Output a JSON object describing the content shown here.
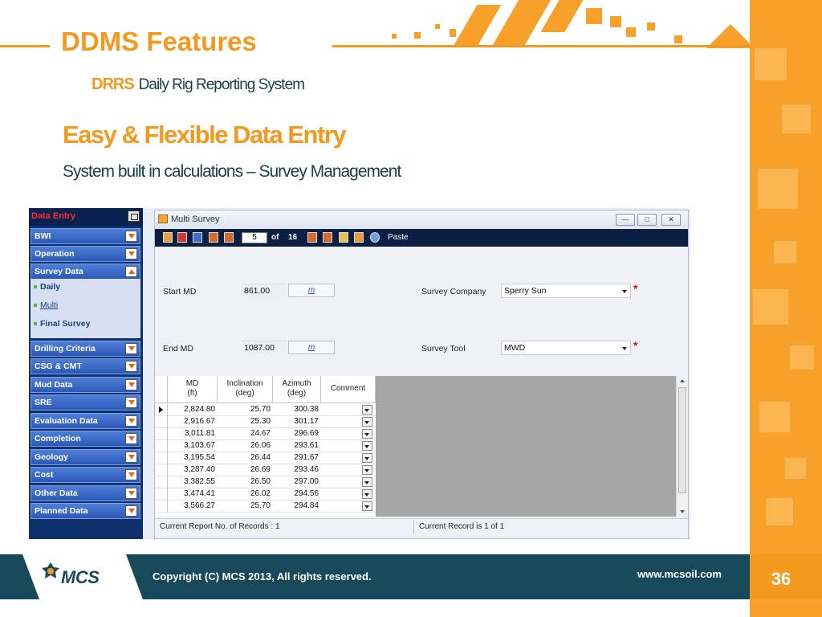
{
  "slide": {
    "title": "DDMS Features",
    "drrs_abbr": "DRRS",
    "drrs_full": "Daily Rig Reporting System",
    "heading": "Easy & Flexible Data Entry",
    "subheading": "System built in calculations – Survey Management",
    "page_number": "36"
  },
  "sidebar": {
    "header": "Data Entry",
    "items": [
      {
        "label": "BWI"
      },
      {
        "label": "Operation"
      },
      {
        "label": "Survey Data"
      },
      {
        "label": "Drilling Criteria"
      },
      {
        "label": "CSG & CMT"
      },
      {
        "label": "Mud Data"
      },
      {
        "label": "SRE"
      },
      {
        "label": "Evaluation Data"
      },
      {
        "label": "Completion"
      },
      {
        "label": "Geology"
      },
      {
        "label": "Cost"
      },
      {
        "label": "Other Data"
      },
      {
        "label": "Planned Data"
      }
    ],
    "survey_sub": [
      {
        "label": "Daily"
      },
      {
        "label": "Multi"
      },
      {
        "label": "Final Survey"
      }
    ]
  },
  "window": {
    "title": "Multi Survey",
    "pager_current": "5",
    "pager_of": "of",
    "pager_total": "16",
    "paste_label": "Paste"
  },
  "form": {
    "start_md_label": "Start MD",
    "start_md_value": "861.00",
    "end_md_label": "End MD",
    "end_md_value": "1087.00",
    "unit": "m",
    "survey_company_label": "Survey Company",
    "survey_company_value": "Sperry Sun",
    "survey_tool_label": "Survey Tool",
    "survey_tool_value": "MWD",
    "required_mark": "*"
  },
  "grid": {
    "headers": {
      "md": "MD",
      "md_unit": "(ft)",
      "inclination": "Inclination",
      "inclination_unit": "(deg)",
      "azimuth": "Azimuth",
      "azimuth_unit": "(deg)",
      "comment": "Comment"
    },
    "rows": [
      {
        "md": "2,824.80",
        "inc": "25.70",
        "azi": "300.38"
      },
      {
        "md": "2,916.67",
        "inc": "25.30",
        "azi": "301.17"
      },
      {
        "md": "3,011.81",
        "inc": "24.67",
        "azi": "296.69"
      },
      {
        "md": "3,103.67",
        "inc": "26.06",
        "azi": "293.61"
      },
      {
        "md": "3,195.54",
        "inc": "26.44",
        "azi": "291.67"
      },
      {
        "md": "3,287.40",
        "inc": "26.69",
        "azi": "293.46"
      },
      {
        "md": "3,382.55",
        "inc": "26.50",
        "azi": "297.00"
      },
      {
        "md": "3,474.41",
        "inc": "26.02",
        "azi": "294.56"
      },
      {
        "md": "3,566.27",
        "inc": "25.70",
        "azi": "294.84"
      }
    ]
  },
  "status": {
    "left": "Current Report No. of Records : 1",
    "right": "Current Record is 1 of 1"
  },
  "footer": {
    "logo_text": "MCS",
    "copyright": "Copyright (C) MCS 2013, All rights reserved.",
    "website": "www.mcsoil.com"
  },
  "colors": {
    "accent_orange": "#f39a1e",
    "footer_teal": "#17495a",
    "nav_blue": "#2a58b8"
  }
}
